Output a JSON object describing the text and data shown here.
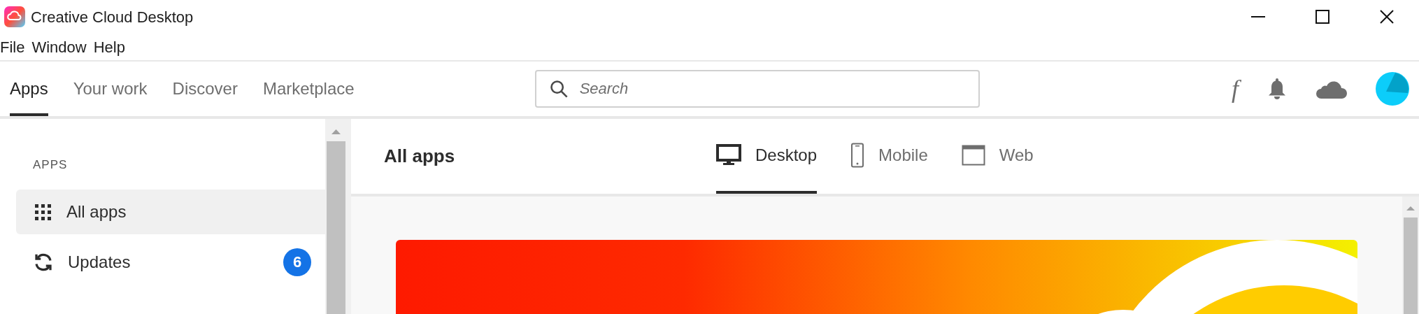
{
  "window": {
    "title": "Creative Cloud Desktop"
  },
  "menu": [
    "File",
    "Window",
    "Help"
  ],
  "nav_tabs": [
    {
      "label": "Apps",
      "selected": true
    },
    {
      "label": "Your work",
      "selected": false
    },
    {
      "label": "Discover",
      "selected": false
    },
    {
      "label": "Marketplace",
      "selected": false
    }
  ],
  "search": {
    "placeholder": "Search"
  },
  "font_icon": "f",
  "sidebar": {
    "heading": "APPS",
    "items": [
      {
        "kind": "grid",
        "label": "All apps",
        "selected": true
      },
      {
        "kind": "refresh",
        "label": "Updates",
        "selected": false,
        "badge": "6"
      }
    ]
  },
  "main": {
    "title": "All apps",
    "platform_tabs": [
      {
        "kind": "desktop",
        "label": "Desktop",
        "selected": true
      },
      {
        "kind": "mobile",
        "label": "Mobile",
        "selected": false
      },
      {
        "kind": "web",
        "label": "Web",
        "selected": false
      }
    ]
  }
}
